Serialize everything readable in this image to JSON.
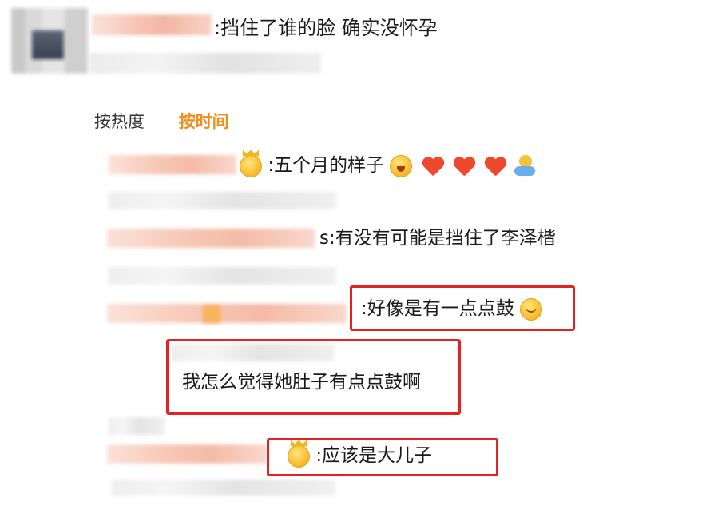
{
  "post": {
    "text": ":挡住了谁的脸 确实没怀孕"
  },
  "sort": {
    "by_hot": "按热度",
    "by_time": "按时间"
  },
  "comments": [
    {
      "text": ":五个月的样子",
      "emojis": [
        "crown-face-emoji",
        "cry-face-emoji",
        "heart-emoji",
        "heart-emoji",
        "heart-emoji",
        "hug-emoji"
      ]
    },
    {
      "text": "s:有没有可能是挡住了李泽楷"
    },
    {
      "text": ":好像是有一点点鼓",
      "highlighted": true
    },
    {
      "text": "我怎么觉得她肚子有点点鼓啊",
      "highlighted": true
    },
    {
      "text": ":应该是大儿子",
      "highlighted": true
    }
  ],
  "colors": {
    "accent": "#f28c1b",
    "highlight_box": "#e52222",
    "heart": "#f0482c"
  }
}
